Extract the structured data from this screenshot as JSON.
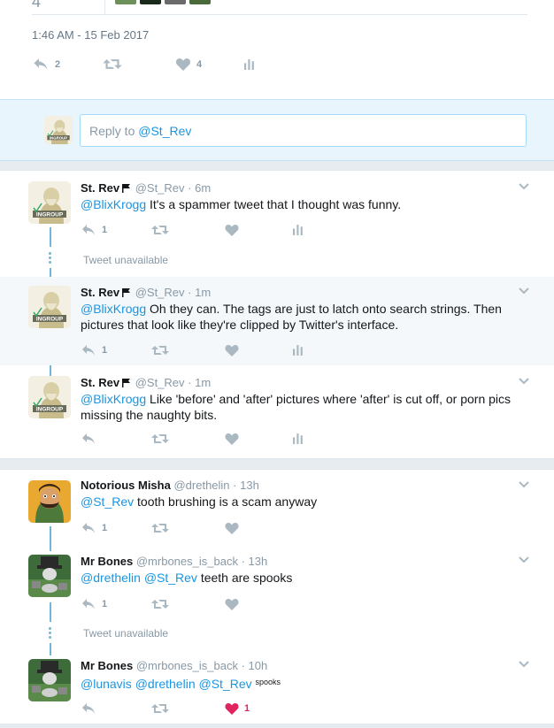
{
  "top_tweet": {
    "partial_count": "4",
    "timestamp": "1:46 AM - 15 Feb 2017",
    "reply_count": "2",
    "like_count": "4"
  },
  "reply_box": {
    "prompt": "Reply to ",
    "mention": "@St_Rev"
  },
  "thread1": {
    "tweets": [
      {
        "name": "St. Rev",
        "handle": "@St_Rev",
        "sep": "·",
        "ago": "6m",
        "mention": "@BlixKrogg",
        "body": " It's a spammer tweet that I thought was funny.",
        "reply_count": "1"
      },
      {
        "name": "St. Rev",
        "handle": "@St_Rev",
        "sep": "·",
        "ago": "1m",
        "mention": "@BlixKrogg",
        "body": " Oh they can. The tags are just to latch onto search strings. Then pictures that look like they're clipped by Twitter's interface.",
        "reply_count": "1"
      },
      {
        "name": "St. Rev",
        "handle": "@St_Rev",
        "sep": "·",
        "ago": "1m",
        "mention": "@BlixKrogg",
        "body": " Like 'before' and 'after' pictures where 'after' is cut off, or porn pics missing the naughty bits."
      }
    ],
    "unavailable": "Tweet unavailable"
  },
  "thread2": {
    "tweets": [
      {
        "name": "Notorious Misha",
        "handle": "@drethelin",
        "sep": "·",
        "ago": "13h",
        "mention": "@St_Rev",
        "body": " tooth brushing is a scam anyway",
        "reply_count": "1"
      },
      {
        "name": "Mr Bones",
        "handle": "@mrbones_is_back",
        "sep": "·",
        "ago": "13h",
        "mention1": "@drethelin",
        "mention2": "@St_Rev",
        "body": " teeth are spooks",
        "reply_count": "1"
      },
      {
        "name": "Mr Bones",
        "handle": "@mrbones_is_back",
        "sep": "·",
        "ago": "10h",
        "mention1": "@lunavis",
        "mention2": "@drethelin",
        "mention3": "@St_Rev",
        "small_text": "spooks",
        "like_count": "1"
      }
    ],
    "unavailable": "Tweet unavailable"
  },
  "icons": {
    "reply": "reply-icon",
    "retweet": "retweet-icon",
    "like": "heart-icon",
    "analytics": "analytics-icon",
    "more": "chevron-down-icon",
    "flag": "flag-icon"
  },
  "colors": {
    "link": "#1b95e0",
    "muted": "#8899a6",
    "like_active": "#e0245e",
    "reply_bg": "#e8f5fd",
    "thread_line": "#6fb7d9"
  }
}
